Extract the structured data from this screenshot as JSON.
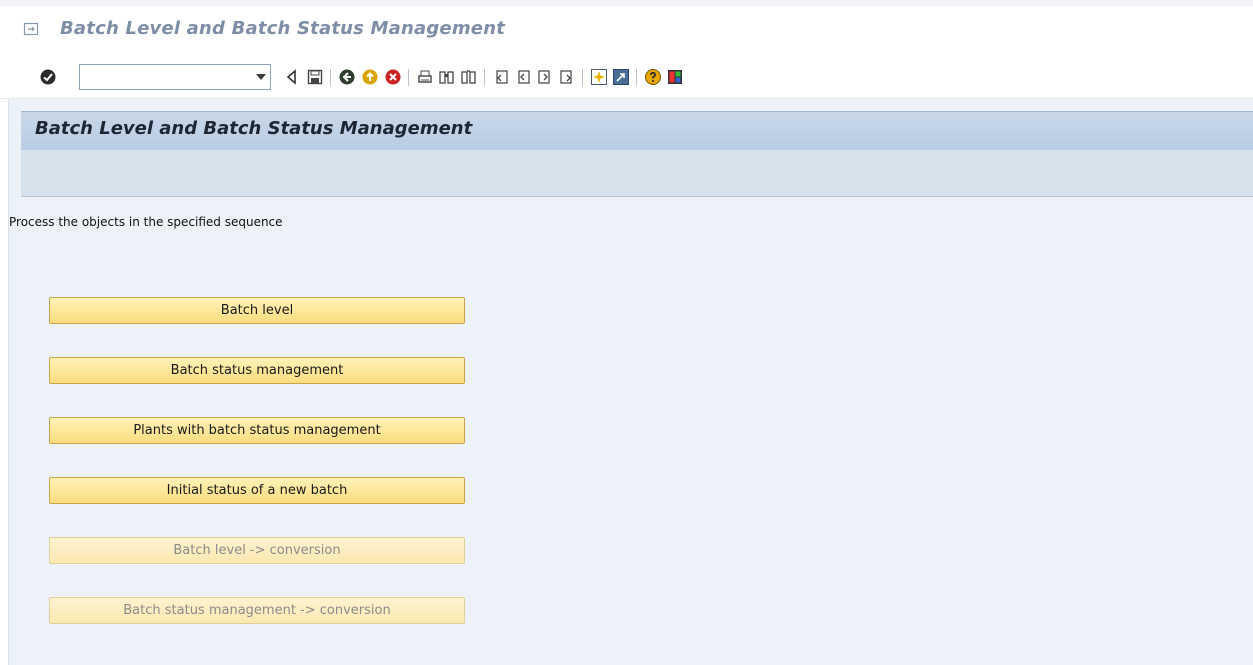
{
  "window": {
    "title": "Batch Level and Batch Status Management"
  },
  "toolbar": {
    "command_field_value": "",
    "icons": [
      "enter-icon",
      "back-arrow-icon",
      "save-icon",
      "back-icon",
      "exit-icon",
      "cancel-icon",
      "print-icon",
      "find-icon",
      "find-next-icon",
      "first-page-icon",
      "previous-page-icon",
      "next-page-icon",
      "last-page-icon",
      "create-session-icon",
      "shortcut-icon",
      "help-icon",
      "customize-layout-icon"
    ]
  },
  "main": {
    "header_title": "Batch Level and Batch Status Management",
    "instruction": "Process the objects in the specified sequence",
    "buttons": [
      {
        "label": "Batch level",
        "enabled": true
      },
      {
        "label": "Batch status management",
        "enabled": true
      },
      {
        "label": "Plants with batch status management",
        "enabled": true
      },
      {
        "label": "Initial status of a new batch",
        "enabled": true
      },
      {
        "label": "Batch level -> conversion",
        "enabled": false
      },
      {
        "label": "Batch status management -> conversion",
        "enabled": false
      }
    ]
  },
  "colors": {
    "title_text": "#7d8ea6",
    "content_bg": "#edf2f8",
    "header_band": "#c0d1e6",
    "button_fill": "#fbdc7e",
    "button_disabled_fill": "#fbe8b0"
  }
}
